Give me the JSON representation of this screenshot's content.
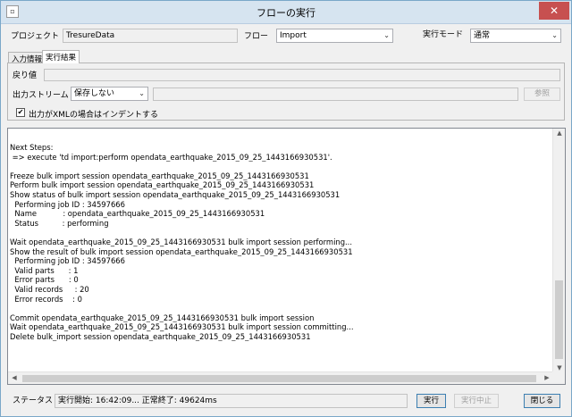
{
  "window": {
    "title": "フローの実行",
    "close_label": "✕"
  },
  "form": {
    "project_label": "プロジェクト",
    "project_value": "TresureData",
    "flow_label": "フロー",
    "flow_value": "Import",
    "mode_label": "実行モード",
    "mode_value": "通常"
  },
  "tabs": [
    {
      "label": "入力情報",
      "active": false
    },
    {
      "label": "実行結果",
      "active": true
    }
  ],
  "panel": {
    "return_label": "戻り値",
    "return_value": "",
    "stream_label": "出力ストリーム",
    "stream_value": "保存しない",
    "stream_path": "",
    "browse_label": "参照",
    "indent_label": "出力がXMLの場合はインデントする",
    "indent_checked": true
  },
  "output": {
    "lines": [
      "Next Steps:",
      " => execute 'td import:perform opendata_earthquake_2015_09_25_1443166930531'.",
      "",
      "Freeze bulk import session opendata_earthquake_2015_09_25_1443166930531",
      "Perform bulk import session opendata_earthquake_2015_09_25_1443166930531",
      "Show status of bulk import session opendata_earthquake_2015_09_25_1443166930531",
      "  Performing job ID : 34597666",
      "  Name           : opendata_earthquake_2015_09_25_1443166930531",
      "  Status          : performing",
      "",
      "Wait opendata_earthquake_2015_09_25_1443166930531 bulk import session performing...",
      "Show the result of bulk import session opendata_earthquake_2015_09_25_1443166930531",
      "  Performing job ID : 34597666",
      "  Valid parts      : 1",
      "  Error parts      : 0",
      "  Valid records     : 20",
      "  Error records    : 0",
      "",
      "Commit opendata_earthquake_2015_09_25_1443166930531 bulk import session",
      "Wait opendata_earthquake_2015_09_25_1443166930531 bulk import session committing...",
      "Delete bulk_import session opendata_earthquake_2015_09_25_1443166930531"
    ]
  },
  "statusbar": {
    "status_label": "ステータス",
    "status_value": "実行開始: 16:42:09... 正常終了: 49624ms",
    "run_label": "実行",
    "stop_label": "実行中止",
    "close_label": "閉じる"
  }
}
